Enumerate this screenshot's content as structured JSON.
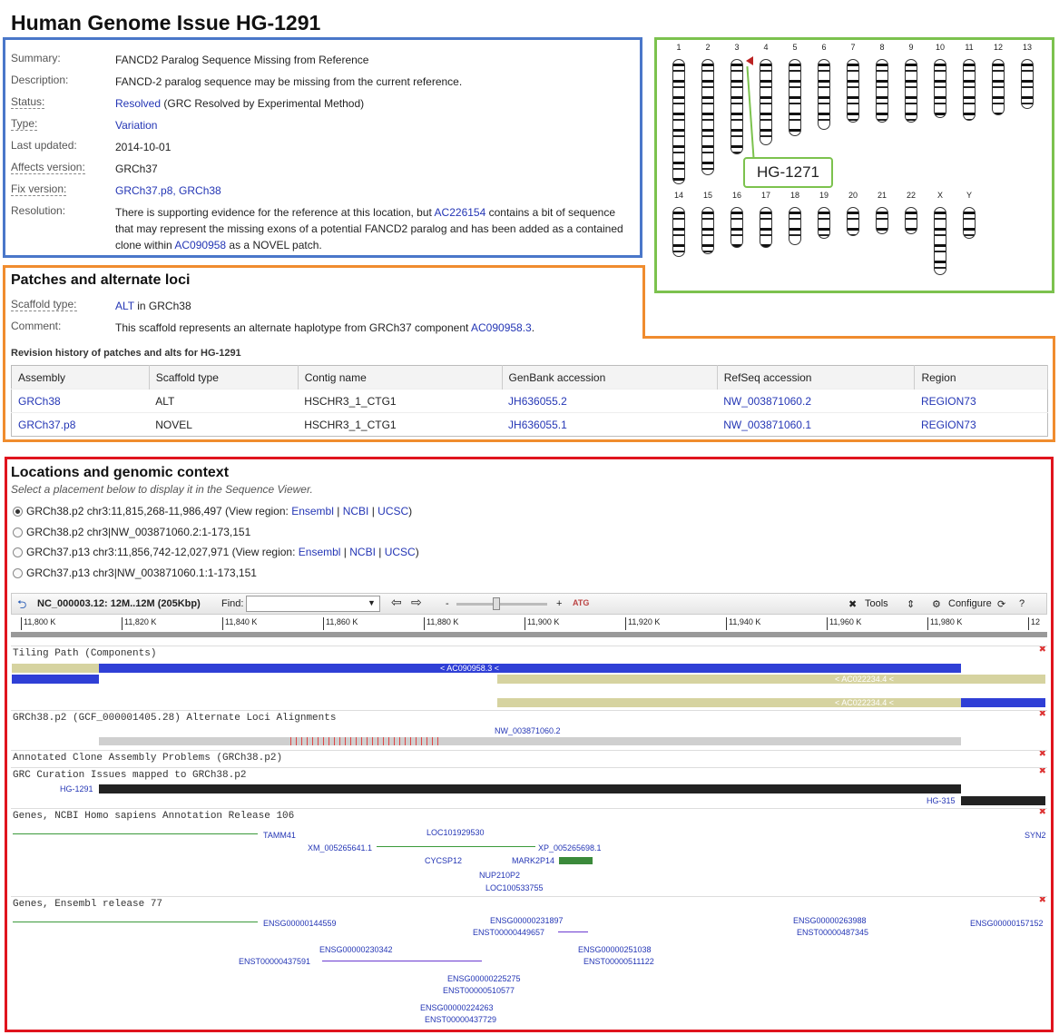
{
  "title": "Human Genome Issue HG-1291",
  "issue": {
    "summary_k": "Summary:",
    "summary": "FANCD2 Paralog Sequence Missing from Reference",
    "desc_k": "Description:",
    "desc": "FANCD-2 paralog sequence may be missing from the current reference.",
    "status_k": "Status:",
    "status_link": "Resolved",
    "status_rest": "(GRC Resolved by Experimental Method)",
    "type_k": "Type:",
    "type": "Variation",
    "updated_k": "Last updated:",
    "updated": "2014-10-01",
    "affects_k": "Affects version:",
    "affects": "GRCh37",
    "fix_k": "Fix version:",
    "fix": "GRCh37.p8, GRCh38",
    "res_k": "Resolution:",
    "res_1a": "There is supporting evidence for the reference at this location, but ",
    "res_1link": "AC226154",
    "res_1b": " contains a bit of sequence",
    "res_2": "that may represent the missing exons of a potential FANCD2 paralog and has been added as a contained",
    "res_3a": "clone within ",
    "res_3link": "AC090958",
    "res_3b": " as a NOVEL patch."
  },
  "ideogram": {
    "chromosomes_top": [
      "1",
      "2",
      "3",
      "4",
      "5",
      "6",
      "7",
      "8",
      "9",
      "10",
      "11",
      "12",
      "13"
    ],
    "chromosomes_bottom": [
      "14",
      "15",
      "16",
      "17",
      "18",
      "19",
      "20",
      "21",
      "22",
      "X",
      "Y"
    ],
    "callout": "HG-1271"
  },
  "patches": {
    "heading": "Patches and alternate loci",
    "scaffold_k": "Scaffold type:",
    "scaffold_link": "ALT",
    "scaffold_rest": "in GRCh38",
    "comment_k": "Comment:",
    "comment": "This scaffold represents an alternate haplotype from GRCh37 component ",
    "comment_link": "AC090958.3",
    "revision_title": "Revision history of patches and alts for HG-1291",
    "columns": [
      "Assembly",
      "Scaffold type",
      "Contig name",
      "GenBank accession",
      "RefSeq accession",
      "Region"
    ],
    "rows": [
      [
        "GRCh38",
        "ALT",
        "HSCHR3_1_CTG1",
        "JH636055.2",
        "NW_003871060.2",
        "REGION73"
      ],
      [
        "GRCh37.p8",
        "NOVEL",
        "HSCHR3_1_CTG1",
        "JH636055.1",
        "NW_003871060.1",
        "REGION73"
      ]
    ]
  },
  "locations": {
    "heading": "Locations and genomic context",
    "sub": "Select a placement below to display it in the Sequence Viewer.",
    "opt1": "GRCh38.p2 chr3:11,815,268-11,986,497 (View region: ",
    "opt2": "GRCh38.p2 chr3|NW_003871060.2:1-173,151",
    "opt3": "GRCh37.p13 chr3:11,856,742-12,027,971 (View region: ",
    "opt4": "GRCh37.p13 chr3|NW_003871060.1:1-173,151",
    "ensembl": "Ensembl",
    "ncbi": "NCBI",
    "ucsc": "UCSC"
  },
  "viewer": {
    "seq": "NC_000003.12: 12M..12M (205Kbp)",
    "find": "Find:",
    "tools": "Tools",
    "configure": "Configure",
    "ticks": [
      "11,800 K",
      "11,820 K",
      "11,840 K",
      "11,860 K",
      "11,880 K",
      "11,900 K",
      "11,920 K",
      "11,940 K",
      "11,960 K",
      "11,980 K",
      "12"
    ],
    "tracks": {
      "tiling": "Tiling Path (Components)",
      "alt": "GRCh38.p2 (GCF_000001405.28) Alternate Loci Alignments",
      "acap": "Annotated Clone Assembly Problems (GRCh38.p2)",
      "grc": "GRC Curation Issues mapped to GRCh38.p2",
      "ncbi": "Genes, NCBI Homo sapiens Annotation Release 106",
      "ens": "Genes, Ensembl release 77"
    },
    "labels": {
      "ac090958": "< AC090958.3 <",
      "ac022234a": "< AC022234.4 <",
      "ac022234b": "< AC022234.4 <",
      "nw": "NW_003871060.2",
      "hg1291": "HG-1291",
      "hg315": "HG-315",
      "tamm41": "TAMM41",
      "xm": "XM_005265641.1",
      "loc": "LOC101929530",
      "xp": "XP_005265698.1",
      "syn": "SYN2",
      "cycsp": "CYCSP12",
      "mark": "MARK2P14",
      "nup": "NUP210P2",
      "loc2": "LOC100533755",
      "e1": "ENSG00000144559",
      "e2": "ENSG00000231897",
      "e3": "ENST00000449657",
      "e4": "ENSG00000263988",
      "e5": "ENST00000487345",
      "e6": "ENSG00000157152",
      "e7": "ENSG00000230342",
      "e8": "ENST00000437591",
      "e9": "ENSG00000251038",
      "e10": "ENST00000511122",
      "e11": "ENSG00000225275",
      "e12": "ENST00000510577",
      "e13": "ENSG00000224263",
      "e14": "ENST00000437729"
    }
  }
}
